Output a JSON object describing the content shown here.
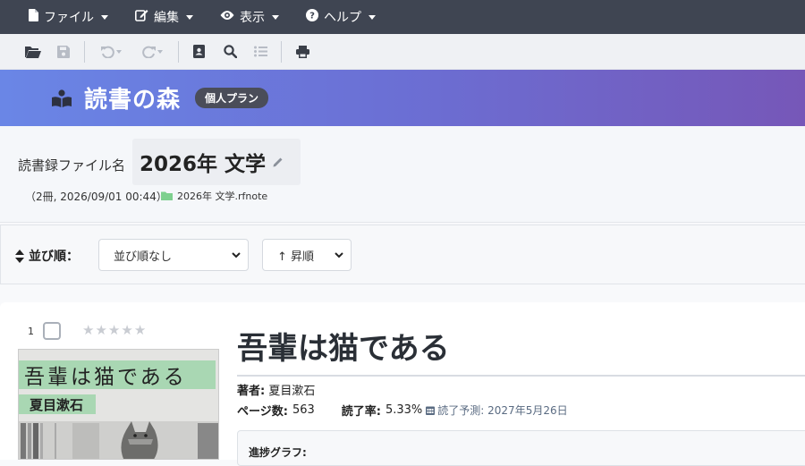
{
  "menu": {
    "file": "ファイル",
    "edit": "編集",
    "view": "表示",
    "help": "ヘルプ"
  },
  "banner": {
    "title": "読書の森",
    "plan": "個人プラン"
  },
  "file_header": {
    "label": "読書録ファイル名",
    "name": "2026年 文学",
    "meta": "（2冊, 2026/09/01 00:44）",
    "path": "2026年 文学.rfnote"
  },
  "sort": {
    "label": "並び順：",
    "order_selected": "並び順なし",
    "direction_selected": "↑ 昇順"
  },
  "book": {
    "rank": "1",
    "rating": 0,
    "cover_title": "吾輩は猫である",
    "cover_author": "夏目漱石",
    "title": "吾輩は猫である",
    "author_label": "著者:",
    "author": "夏目漱石",
    "pages_label": "ページ数:",
    "pages": "563",
    "progress_label": "読了率:",
    "progress": "5.33%",
    "eta": "読了予測: 2027年5月26日",
    "graph_label": "進捗グラフ:"
  },
  "colors": {
    "menubar": "#3f4552",
    "banner_start": "#6a86e6",
    "banner_end": "#7657b8",
    "badge": "#4a4d59",
    "folder_icon": "#7ed08f"
  }
}
